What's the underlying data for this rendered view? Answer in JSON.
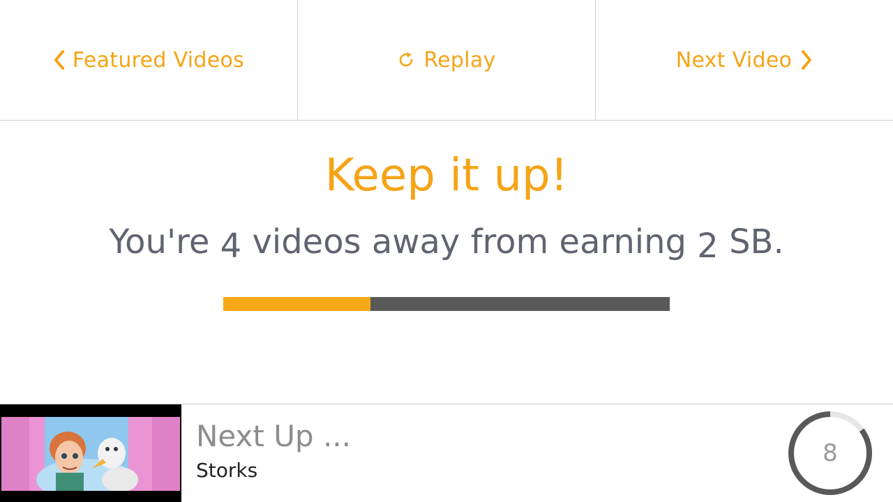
{
  "nav": {
    "back_label": "Featured Videos",
    "replay_label": "Replay",
    "next_label": "Next Video"
  },
  "headline": "Keep it up!",
  "message": {
    "prefix": "You're ",
    "videos_remaining": "4",
    "middle": " videos away from earning ",
    "reward_amount": "2",
    "suffix": " SB."
  },
  "progress": {
    "fraction": 0.33
  },
  "next_up": {
    "heading": "Next Up ...",
    "title": "Storks",
    "countdown": "8",
    "countdown_remaining_fraction": 0.85
  },
  "colors": {
    "accent": "#f5a416",
    "progress_track": "#595959",
    "text_gray": "#5f6470"
  },
  "icons": [
    "chevron-left-icon",
    "replay-icon",
    "chevron-right-icon"
  ]
}
